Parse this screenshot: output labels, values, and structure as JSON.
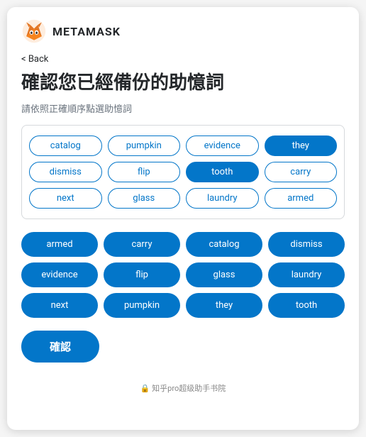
{
  "header": {
    "logo_alt": "MetaMask Fox",
    "title": "METAMASK"
  },
  "nav": {
    "back_label": "< Back"
  },
  "main": {
    "page_title": "確認您已經備份的助憶詞",
    "subtitle": "請依照正確順序點選助憶詞",
    "confirm_button_label": "確認"
  },
  "word_pool": {
    "words": [
      {
        "id": "catalog",
        "label": "catalog",
        "selected": false
      },
      {
        "id": "pumpkin",
        "label": "pumpkin",
        "selected": false
      },
      {
        "id": "evidence",
        "label": "evidence",
        "selected": false
      },
      {
        "id": "they",
        "label": "they",
        "selected": true
      },
      {
        "id": "dismiss",
        "label": "dismiss",
        "selected": false
      },
      {
        "id": "flip",
        "label": "flip",
        "selected": false
      },
      {
        "id": "tooth",
        "label": "tooth",
        "selected": true
      },
      {
        "id": "carry",
        "label": "carry",
        "selected": false
      },
      {
        "id": "next",
        "label": "next",
        "selected": false
      },
      {
        "id": "glass",
        "label": "glass",
        "selected": false
      },
      {
        "id": "laundry",
        "label": "laundry",
        "selected": false
      },
      {
        "id": "armed",
        "label": "armed",
        "selected": false
      }
    ]
  },
  "selected_words": [
    {
      "id": "armed",
      "label": "armed"
    },
    {
      "id": "carry",
      "label": "carry"
    },
    {
      "id": "catalog",
      "label": "catalog"
    },
    {
      "id": "dismiss",
      "label": "dismiss"
    },
    {
      "id": "evidence",
      "label": "evidence"
    },
    {
      "id": "flip",
      "label": "flip"
    },
    {
      "id": "glass",
      "label": "glass"
    },
    {
      "id": "laundry",
      "label": "laundry"
    },
    {
      "id": "next",
      "label": "next"
    },
    {
      "id": "pumpkin",
      "label": "pumpkin"
    },
    {
      "id": "they",
      "label": "they"
    },
    {
      "id": "tooth",
      "label": "tooth"
    }
  ],
  "watermark": {
    "text": "🔒 知乎pro超级助手书院"
  }
}
